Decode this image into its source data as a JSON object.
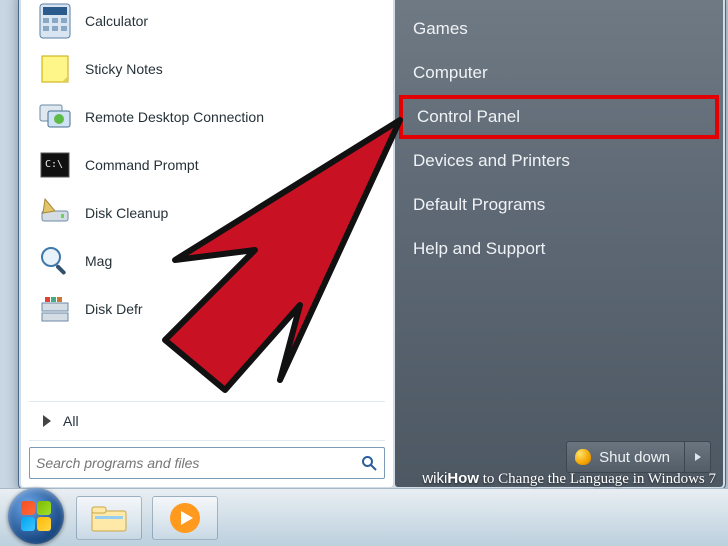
{
  "start_menu": {
    "left": {
      "programs": [
        {
          "label": "Calculator",
          "icon": "calculator-icon"
        },
        {
          "label": "Sticky Notes",
          "icon": "sticky-notes-icon"
        },
        {
          "label": "Remote Desktop Connection",
          "icon": "rdp-icon"
        },
        {
          "label": "Command Prompt",
          "icon": "cmd-icon"
        },
        {
          "label": "Disk Cleanup",
          "icon": "disk-cleanup-icon"
        },
        {
          "label": "Mag",
          "icon": "magnifier-icon"
        },
        {
          "label": "Disk Defr",
          "icon": "defrag-icon"
        }
      ],
      "all_label": "All",
      "search_placeholder": "Search programs and files"
    },
    "right": {
      "items": [
        {
          "label": "Games",
          "highlight": false
        },
        {
          "label": "Computer",
          "highlight": false
        },
        {
          "label": "Control Panel",
          "highlight": true
        },
        {
          "label": "Devices and Printers",
          "highlight": false
        },
        {
          "label": "Default Programs",
          "highlight": false
        },
        {
          "label": "Help and Support",
          "highlight": false
        }
      ],
      "shutdown_label": "Shut down"
    }
  },
  "taskbar": {
    "pinned": [
      "explorer",
      "media-player"
    ]
  },
  "caption": {
    "brand": "wikiHow",
    "text": " to Change the Language in Windows 7"
  }
}
